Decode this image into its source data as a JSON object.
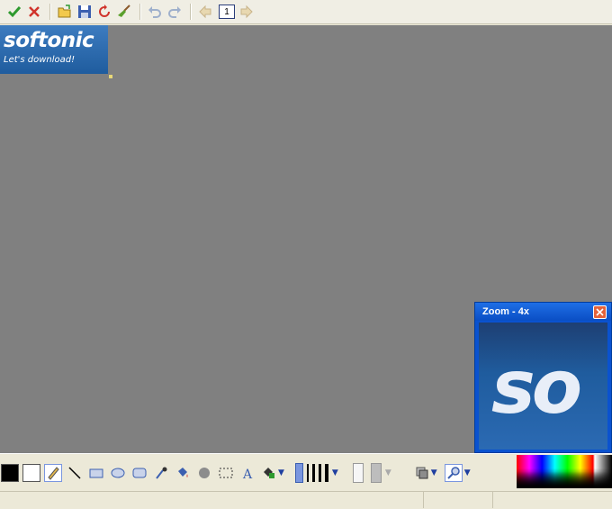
{
  "toolbar": {
    "buttons": [
      {
        "name": "accept-button",
        "icon": "checkmark-icon"
      },
      {
        "name": "cancel-button",
        "icon": "close-x-icon"
      },
      {
        "name": "open-button",
        "icon": "folder-open-icon"
      },
      {
        "name": "save-button",
        "icon": "floppy-disk-icon"
      },
      {
        "name": "refresh-button",
        "icon": "refresh-icon"
      },
      {
        "name": "clear-button",
        "icon": "broom-icon"
      },
      {
        "name": "undo-button",
        "icon": "undo-icon"
      },
      {
        "name": "redo-button",
        "icon": "redo-icon"
      },
      {
        "name": "prev-page-button",
        "icon": "arrow-left-icon"
      },
      {
        "name": "next-page-button",
        "icon": "arrow-right-icon"
      }
    ],
    "page_number": "1"
  },
  "canvas": {
    "background_color": "#808080",
    "logo": {
      "main_text": "softonic",
      "sub_text": "Let's download!"
    }
  },
  "zoom_window": {
    "title": "Zoom - 4x",
    "preview_text": "so"
  },
  "palette": {
    "foreground_color": "#000000",
    "background_color": "#FFFFFF",
    "tools": [
      "pencil-icon",
      "line-icon",
      "rectangle-icon",
      "ellipse-icon",
      "rounded-rect-icon",
      "eyedropper-icon",
      "fill-bucket-icon",
      "airbrush-icon",
      "selection-icon",
      "text-icon",
      "color-fill-icon"
    ]
  }
}
